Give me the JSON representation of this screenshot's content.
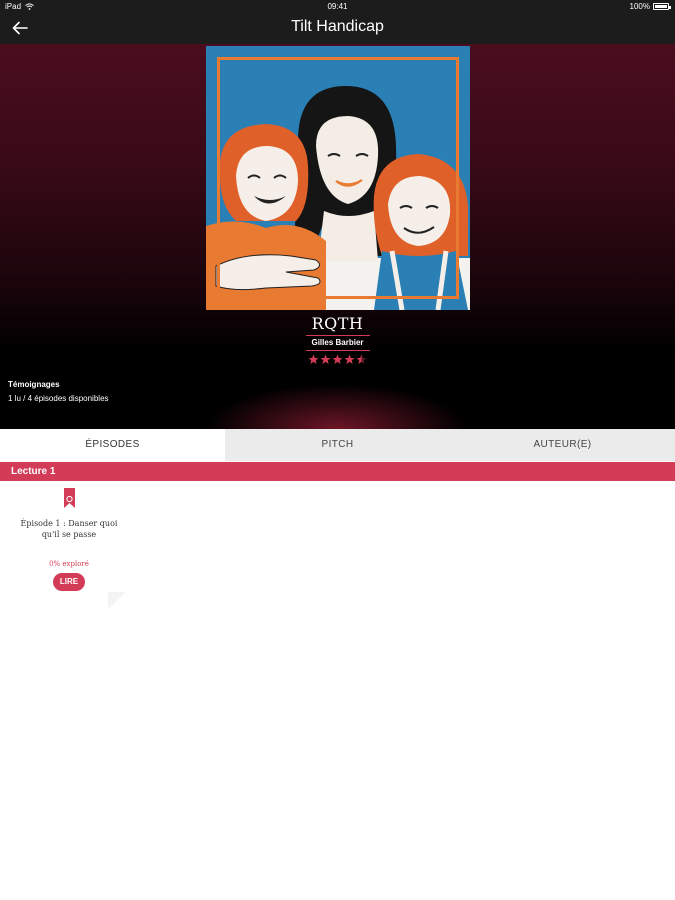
{
  "status_bar": {
    "device": "iPad",
    "time": "09:41",
    "battery": "100%"
  },
  "nav": {
    "title": "Tilt Handicap",
    "back_icon": "arrow-left-icon"
  },
  "book": {
    "title": "RQTH",
    "author": "Gilles Barbier",
    "rating": 4.5,
    "rating_max": 5,
    "genre": "Témoignages",
    "availability": "1 lu / 4 épisodes disponibles"
  },
  "tabs": [
    {
      "label": "ÉPISODES",
      "active": true
    },
    {
      "label": "PITCH",
      "active": false
    },
    {
      "label": "AUTEUR(E)",
      "active": false
    }
  ],
  "section": {
    "label": "Lecture 1"
  },
  "episodes": [
    {
      "title": "Épisode 1 : Danser quoi qu'il se passe",
      "progress": "0% exploré",
      "read_label": "LIRE"
    }
  ],
  "colors": {
    "accent": "#d33c57",
    "nav_bg": "#1c1c1c",
    "cover_bg": "#2a7fb5",
    "cover_frame": "#e87a32",
    "tab_bg": "#ebebeb"
  }
}
